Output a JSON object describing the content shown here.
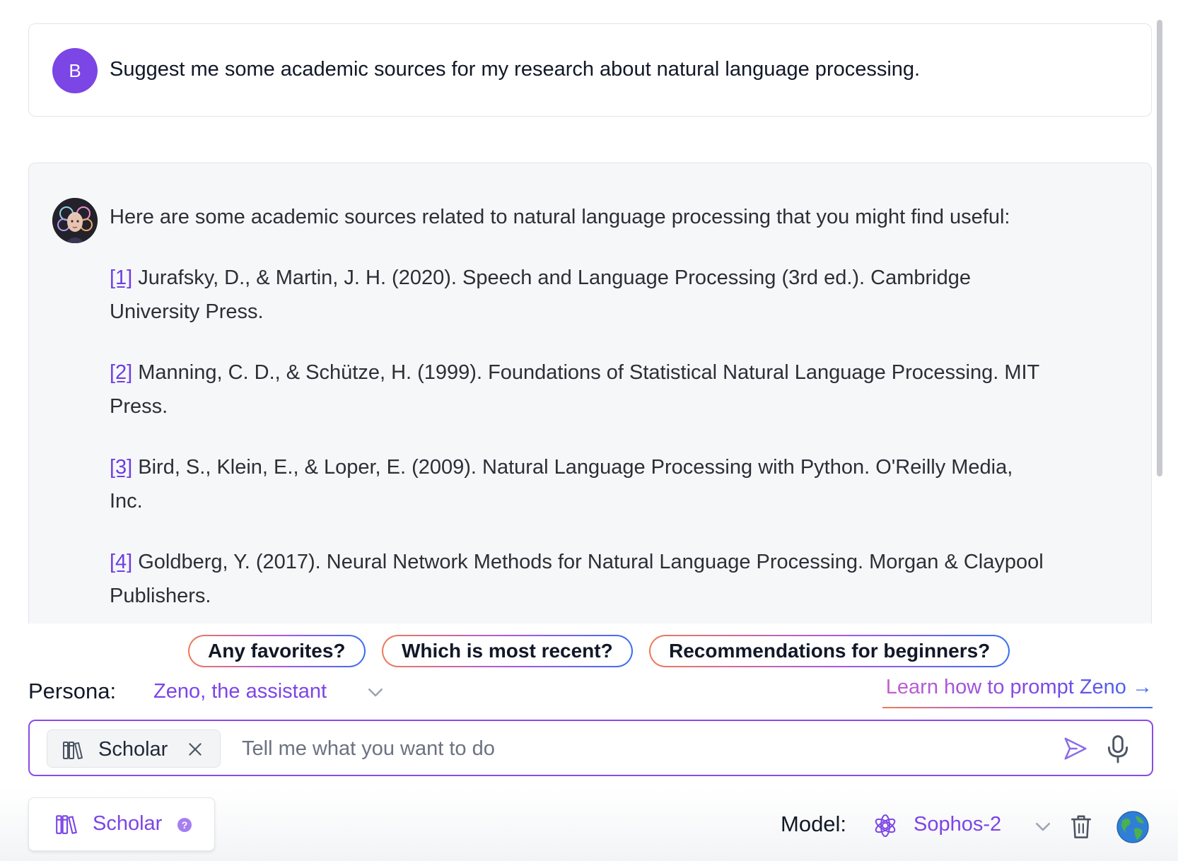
{
  "conversation": {
    "user_message": {
      "avatar_initial": "B",
      "text": "Suggest me some academic sources for my research about natural language processing."
    },
    "assistant_message": {
      "intro": "Here are some academic sources related to natural language processing that you might find useful:",
      "references": [
        {
          "num": "[1]",
          "text": "Jurafsky, D., & Martin, J. H. (2020). Speech and Language Processing (3rd ed.). Cambridge University Press."
        },
        {
          "num": "[2]",
          "text": "Manning, C. D., & Schütze, H. (1999). Foundations of Statistical Natural Language Processing. MIT Press."
        },
        {
          "num": "[3]",
          "text": "Bird, S., Klein, E., & Loper, E. (2009). Natural Language Processing with Python. O'Reilly Media, Inc."
        },
        {
          "num": "[4]",
          "text": "Goldberg, Y. (2017). Neural Network Methods for Natural Language Processing. Morgan & Claypool Publishers."
        }
      ]
    }
  },
  "suggestions": [
    "Any favorites?",
    "Which is most recent?",
    "Recommendations for beginners?"
  ],
  "persona": {
    "label": "Persona:",
    "value": "Zeno, the assistant",
    "learn_link": "Learn how to prompt Zeno →"
  },
  "input": {
    "mode_chip": "Scholar",
    "placeholder": "Tell me what you want to do",
    "value": ""
  },
  "bottom": {
    "mode_button": "Scholar",
    "mode_help": "?",
    "model_label": "Model:",
    "model_value": "Sophos-2"
  },
  "colors": {
    "accent": "#7c45e6",
    "user_avatar": "#7c45e6",
    "assistant_card_bg": "#f6f7f9"
  },
  "icons": {
    "user_avatar": "avatar-initial",
    "assistant_avatar": "assistant-portrait-icon",
    "scholar": "books-icon",
    "remove": "close-icon",
    "send": "send-icon",
    "mic": "microphone-icon",
    "model": "brain-icon",
    "dropdown": "chevron-down-icon",
    "delete": "trash-icon",
    "web": "globe-icon"
  }
}
